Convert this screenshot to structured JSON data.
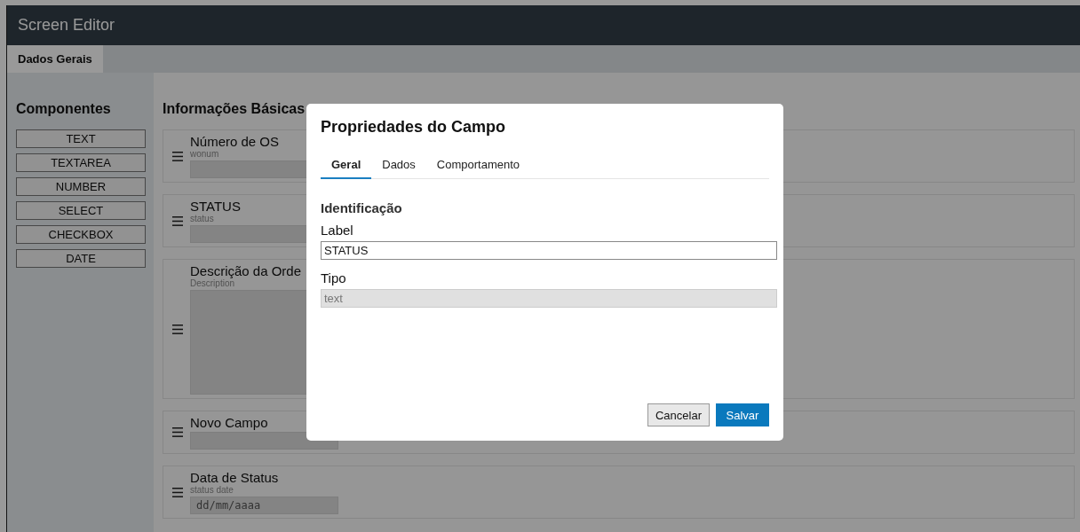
{
  "app": {
    "title": "Screen Editor"
  },
  "tabs": [
    {
      "label": "Dados Gerais",
      "selected": true
    }
  ],
  "sidebar": {
    "title": "Componentes",
    "components": [
      "TEXT",
      "TEXTAREA",
      "NUMBER",
      "SELECT",
      "CHECKBOX",
      "DATE"
    ]
  },
  "section": {
    "title": "Informações Básicas",
    "fields": [
      {
        "label": "Número de OS",
        "name": "wonum",
        "kind": "text"
      },
      {
        "label": "STATUS",
        "name": "status",
        "kind": "text"
      },
      {
        "label": "Descrição da Orde",
        "name": "Description",
        "kind": "textarea"
      },
      {
        "label": "Novo Campo",
        "kind": "text"
      },
      {
        "label": "Data de Status",
        "name": "status date",
        "kind": "date",
        "placeholder": "dd/mm/aaaa"
      }
    ]
  },
  "dialog": {
    "title": "Propriedades do Campo",
    "tabs": [
      {
        "label": "Geral",
        "selected": true
      },
      {
        "label": "Dados",
        "selected": false
      },
      {
        "label": "Comportamento",
        "selected": false
      }
    ],
    "section_title": "Identificação",
    "fields": [
      {
        "label": "Label",
        "value": "STATUS",
        "disabled": false
      },
      {
        "label": "Tipo",
        "value": "text",
        "disabled": true
      }
    ],
    "buttons": [
      {
        "label": "Cancelar",
        "kind": "secondary"
      },
      {
        "label": "Salvar",
        "kind": "primary"
      }
    ]
  }
}
